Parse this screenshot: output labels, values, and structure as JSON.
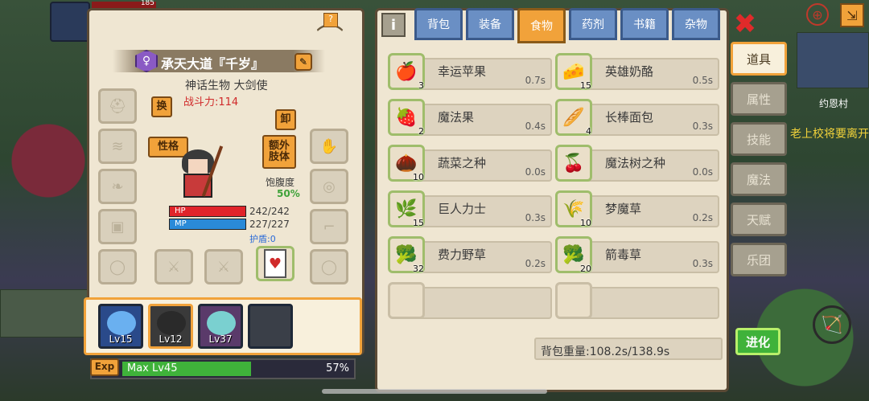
{
  "hud": {
    "top_hp": "185",
    "map_name": "约恩村",
    "npc_text": "老上校将要离开",
    "evolve_label": "进化"
  },
  "character": {
    "name": "承天大道『千岁』",
    "title": "神话生物 大剑使",
    "power": "战斗力:114",
    "swap_label": "换",
    "unequip_label": "卸",
    "personality_label": "性格",
    "extra_limb_label": "额外\n肢体",
    "satiety_label": "饱腹度",
    "satiety_value": "50%",
    "hp_label": "HP",
    "hp_value": "242/242",
    "hp_fraction": 1.0,
    "mp_label": "MP",
    "mp_value": "227/227",
    "mp_fraction": 1.0,
    "shield": "护盾:0"
  },
  "party": [
    {
      "level": "Lv15"
    },
    {
      "level": "Lv12"
    },
    {
      "level": "Lv37"
    },
    {
      "level": ""
    }
  ],
  "exp": {
    "label": "Exp",
    "text": "Max Lv45",
    "percent": "57%",
    "fraction": 0.57
  },
  "tabs": [
    {
      "label": "背包",
      "active": false
    },
    {
      "label": "装备",
      "active": false
    },
    {
      "label": "食物",
      "active": true
    },
    {
      "label": "药剂",
      "active": false
    },
    {
      "label": "书籍",
      "active": false
    },
    {
      "label": "杂物",
      "active": false
    }
  ],
  "info_icon": "i",
  "close_icon": "✖",
  "items": [
    {
      "name": "幸运苹果",
      "count": "3",
      "time": "0.7s",
      "icon": "🍎"
    },
    {
      "name": "英雄奶酪",
      "count": "15",
      "time": "0.5s",
      "icon": "🧀"
    },
    {
      "name": "魔法果",
      "count": "2",
      "time": "0.4s",
      "icon": "🍓"
    },
    {
      "name": "长棒面包",
      "count": "4",
      "time": "0.3s",
      "icon": "🥖"
    },
    {
      "name": "蔬菜之种",
      "count": "10",
      "time": "0.0s",
      "icon": "🌰"
    },
    {
      "name": "魔法树之种",
      "count": "",
      "time": "0.0s",
      "icon": "🍒"
    },
    {
      "name": "巨人力士",
      "count": "15",
      "time": "0.3s",
      "icon": "🌿"
    },
    {
      "name": "梦魔草",
      "count": "10",
      "time": "0.2s",
      "icon": "🌾"
    },
    {
      "name": "费力野草",
      "count": "32",
      "time": "0.2s",
      "icon": "🥦"
    },
    {
      "name": "箭毒草",
      "count": "20",
      "time": "0.3s",
      "icon": "🥦"
    },
    {
      "name": "",
      "count": "",
      "time": "",
      "icon": ""
    },
    {
      "name": "",
      "count": "",
      "time": "",
      "icon": ""
    }
  ],
  "weight": "背包重量:108.2s/138.9s",
  "side_tabs": [
    {
      "label": "道具",
      "active": true
    },
    {
      "label": "属性",
      "active": false
    },
    {
      "label": "技能",
      "active": false
    },
    {
      "label": "魔法",
      "active": false
    },
    {
      "label": "天赋",
      "active": false
    },
    {
      "label": "乐团",
      "active": false
    }
  ],
  "colors": {
    "accent": "#f1a23a",
    "hp": "#e0242a",
    "mp": "#2a8ad8",
    "exp": "#3fb23a",
    "tab": "#6a8fc4"
  }
}
